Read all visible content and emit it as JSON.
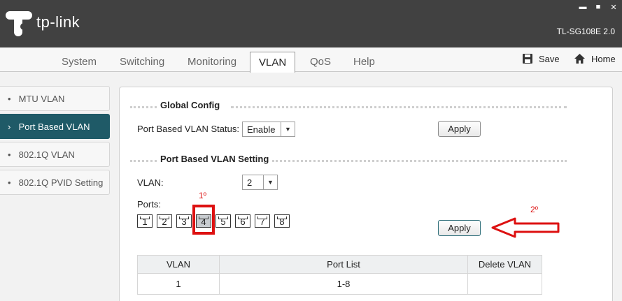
{
  "header": {
    "brand": "tp-link",
    "model": "TL-SG108E 2.0"
  },
  "tabs": [
    "System",
    "Switching",
    "Monitoring",
    "VLAN",
    "QoS",
    "Help"
  ],
  "active_tab": "VLAN",
  "toolbar": {
    "save_label": "Save",
    "home_label": "Home"
  },
  "sidebar": {
    "items": [
      {
        "label": "MTU VLAN",
        "active": false
      },
      {
        "label": "Port Based VLAN",
        "active": true
      },
      {
        "label": "802.1Q VLAN",
        "active": false
      },
      {
        "label": "802.1Q PVID Setting",
        "active": false
      }
    ]
  },
  "global_config": {
    "title": "Global Config",
    "status_label": "Port Based VLAN Status:",
    "status_value": "Enable",
    "apply_label": "Apply"
  },
  "vlan_setting": {
    "title": "Port Based VLAN Setting",
    "vlan_label": "VLAN:",
    "vlan_value": "2",
    "ports_label": "Ports:",
    "ports": [
      "1",
      "2",
      "3",
      "4",
      "5",
      "6",
      "7",
      "8"
    ],
    "selected_port": "4",
    "apply_label": "Apply"
  },
  "table": {
    "headers": [
      "VLAN",
      "Port List",
      "Delete VLAN"
    ],
    "rows": [
      [
        "1",
        "1-8",
        ""
      ]
    ]
  },
  "annotations": {
    "step1": "1º",
    "step2": "2º"
  },
  "colors": {
    "header_bg": "#414141",
    "sidebar_active": "#1f5a67",
    "annotation": "#dd1111"
  }
}
